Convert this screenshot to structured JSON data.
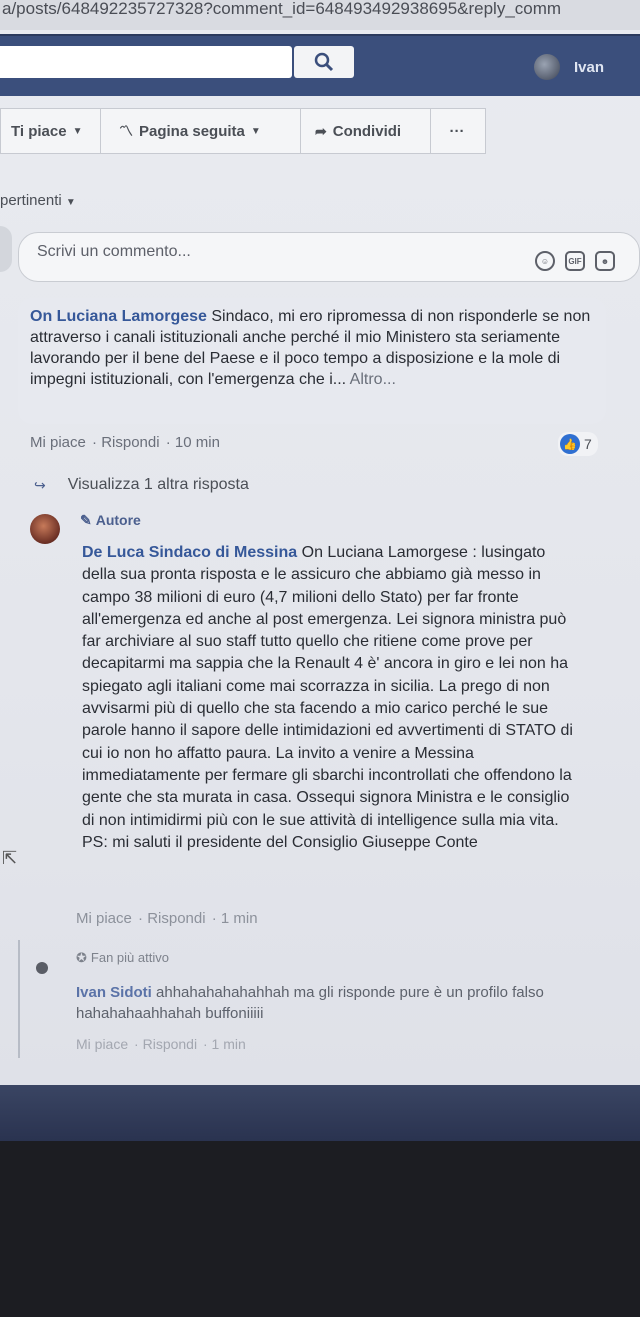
{
  "browser": {
    "url": "a/posts/648492235727328?comment_id=648493492938695&reply_comm"
  },
  "header": {
    "user_name": "Ivan",
    "search_placeholder": ""
  },
  "actions": {
    "like_label": "Ti piace",
    "follow_label": "Pagina seguita",
    "share_label": "Condividi",
    "more_label": "···"
  },
  "filter": {
    "label": "pertinenti"
  },
  "composer": {
    "placeholder": "Scrivi un commento..."
  },
  "comment": {
    "author": "On Luciana Lamorgese",
    "text": " Sindaco, mi ero ripromessa di non risponderle se non attraverso i canali istituzionali anche perché il mio Ministero sta seriamente lavorando per il bene del Paese e il poco tempo a disposizione e la mole di impegni istituzionali, con l'emergenza che i...",
    "more": "Altro...",
    "like": "Mi piace",
    "reply": "Rispondi",
    "time": "10 min",
    "like_count": "7"
  },
  "view_more": {
    "label": "Visualizza 1 altra risposta"
  },
  "reply": {
    "badge": "Autore",
    "author": "De Luca Sindaco di Messina",
    "text": " On Luciana Lamorgese : lusingato della sua pronta risposta e le assicuro che abbiamo già messo in campo 38 milioni di euro (4,7 milioni dello Stato) per far fronte all'emergenza ed anche al post emergenza. Lei signora ministra può far archiviare al suo staff tutto quello che ritiene come prove per decapitarmi ma sappia che la Renault 4 è' ancora in giro e lei non ha spiegato agli italiani come mai scorrazza in sicilia. La prego di non avvisarmi più di quello che sta facendo a mio carico perché le sue parole hanno il sapore delle intimidazioni ed avvertimenti di STATO di cui io non ho affatto paura. La invito a venire a Messina immediatamente per fermare gli sbarchi incontrollati che offendono la gente che sta murata in casa. Ossequi signora Ministra e le consiglio di non intimidirmi più con le sue attività di intelligence sulla mia vita. PS: mi saluti il presidente del Consiglio Giuseppe Conte",
    "like": "Mi piace",
    "reply": "Rispondi",
    "time": "1 min"
  },
  "nested_reply": {
    "badge": "Fan più attivo",
    "author": "Ivan Sidoti",
    "text": " ahhahahahahahhah ma gli risponde pure è un profilo falso hahahahaahhahah buffoniiiii",
    "like": "Mi piace",
    "reply": "Rispondi",
    "time": "1 min"
  }
}
